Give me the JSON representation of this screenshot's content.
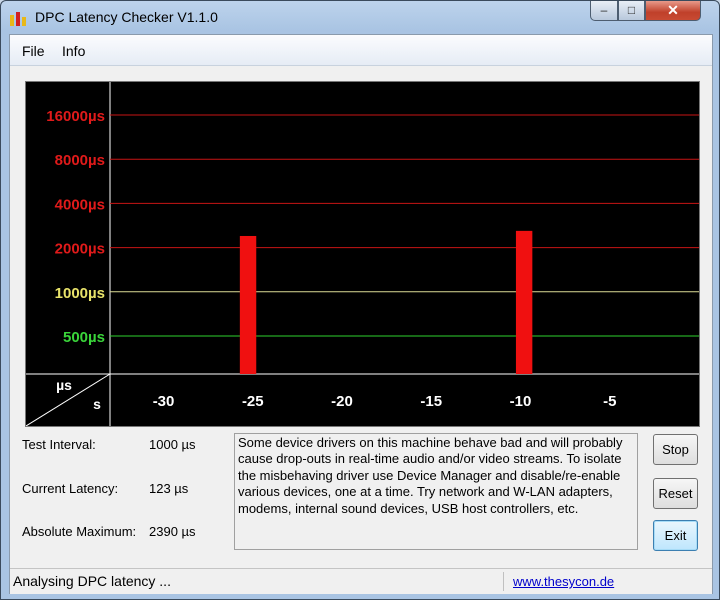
{
  "window": {
    "title": "DPC Latency Checker V1.1.0",
    "controls": {
      "minimize": "–",
      "maximize": "□",
      "close": "✕"
    }
  },
  "menu": {
    "items": [
      "File",
      "Info"
    ]
  },
  "chart_data": {
    "type": "bar",
    "y_scale": "log",
    "y_ticks": [
      {
        "label": "16000µs",
        "value": 16000,
        "color": "#e01a1a",
        "line": "#c81414"
      },
      {
        "label": "8000µs",
        "value": 8000,
        "color": "#e01a1a",
        "line": "#c81414"
      },
      {
        "label": "4000µs",
        "value": 4000,
        "color": "#e01a1a",
        "line": "#c81414"
      },
      {
        "label": "2000µs",
        "value": 2000,
        "color": "#e01a1a",
        "line": "#c81414"
      },
      {
        "label": "1000µs",
        "value": 1000,
        "color": "#e8e36a",
        "line": "#dcdc96"
      },
      {
        "label": "500µs",
        "value": 500,
        "color": "#3ad43a",
        "line": "#2ed22e"
      }
    ],
    "x_ticks": [
      {
        "label": "-30",
        "value": -30
      },
      {
        "label": "-25",
        "value": -25
      },
      {
        "label": "-20",
        "value": -20
      },
      {
        "label": "-15",
        "value": -15
      },
      {
        "label": "-10",
        "value": -10
      },
      {
        "label": "-5",
        "value": -5
      }
    ],
    "x_unit": "s",
    "y_unit": "µs",
    "x_range": [
      -33,
      0
    ],
    "values": [
      140,
      150,
      150,
      150,
      135,
      185,
      130,
      2400,
      140,
      150,
      130,
      145,
      120,
      145,
      140,
      140,
      125,
      150,
      140,
      145,
      135,
      145,
      2600,
      120,
      140,
      140,
      140,
      130,
      160,
      145,
      135,
      150
    ],
    "colors": {
      "normal": "#00e000",
      "high": "#f01010",
      "threshold": 1000
    }
  },
  "info": {
    "test_interval": {
      "label": "Test Interval:",
      "value": "1000 µs"
    },
    "current_latency": {
      "label": "Current Latency:",
      "value": "123 µs"
    },
    "absolute_maximum": {
      "label": "Absolute Maximum:",
      "value": "2390 µs"
    }
  },
  "message": "Some device drivers on this machine behave bad and will probably cause drop-outs in real-time audio and/or video streams. To isolate the misbehaving driver use Device Manager and disable/re-enable various devices, one at a time. Try network and W-LAN adapters, modems, internal sound devices, USB host controllers, etc.",
  "buttons": {
    "stop": "Stop",
    "reset": "Reset",
    "exit": "Exit"
  },
  "status": {
    "text": "Analysing DPC latency ...",
    "link": "www.thesycon.de"
  }
}
